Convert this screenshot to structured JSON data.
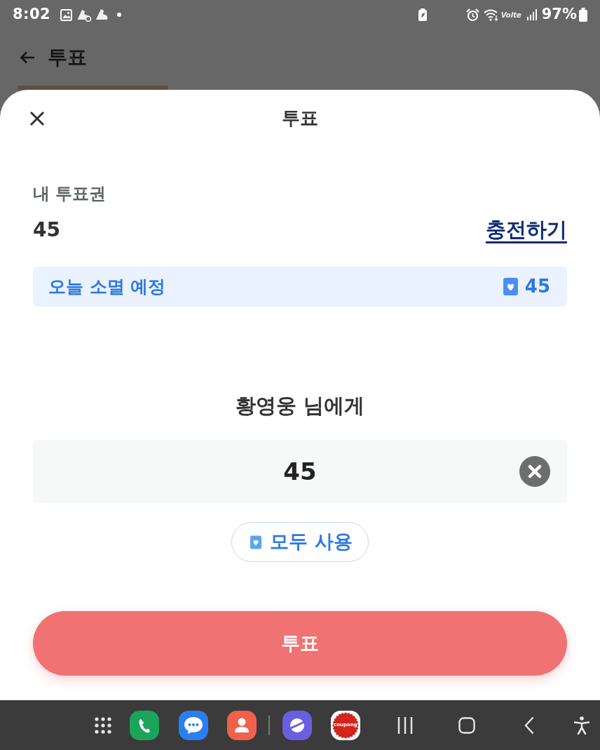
{
  "status_bar": {
    "time": "8:02",
    "network": "Volte",
    "battery": "97%"
  },
  "app_header": {
    "title": "투표"
  },
  "sheet": {
    "title": "투표",
    "my_votes": {
      "label": "내 투표권",
      "count": "45",
      "charge_link": "충전하기"
    },
    "expiring": {
      "label": "오늘 소멸 예정",
      "count": "45"
    },
    "recipient": "황영웅 님에게",
    "amount_field": {
      "value": "45"
    },
    "use_all_button": "모두 사용",
    "vote_button": "투표"
  },
  "nav_bar": {
    "apps": [
      {
        "kind": "grid"
      },
      {
        "kind": "phone"
      },
      {
        "kind": "messages"
      },
      {
        "kind": "contacts"
      },
      {
        "kind": "browser"
      },
      {
        "kind": "shop",
        "label": "coupang"
      }
    ]
  }
}
